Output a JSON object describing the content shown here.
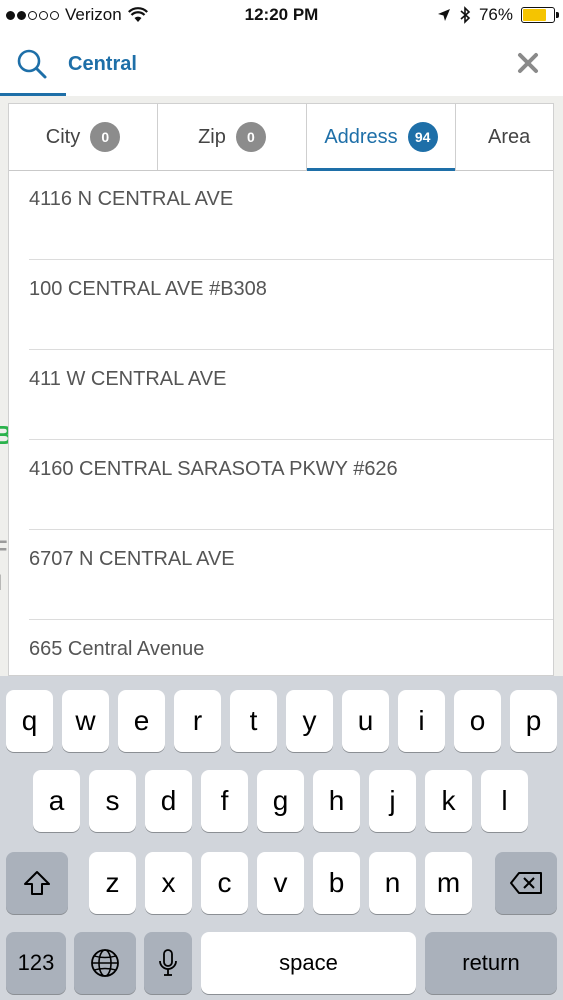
{
  "status_bar": {
    "carrier": "Verizon",
    "time": "12:20 PM",
    "battery": "76%",
    "battery_level": 0.76,
    "icons": [
      "signal-dots-icon",
      "wifi-icon",
      "location-arrow-icon",
      "bluetooth-icon",
      "battery-icon"
    ]
  },
  "search": {
    "value": "Central",
    "icon": "search-icon",
    "clear_icon": "close-icon"
  },
  "colors": {
    "accent": "#1e6fa8",
    "badge_inactive": "#8c8c8c",
    "battery": "#f5c400"
  },
  "tabs": [
    {
      "label": "City",
      "count": "0"
    },
    {
      "label": "Zip",
      "count": "0"
    },
    {
      "label": "Address",
      "count": "94"
    },
    {
      "label": "Area",
      "count": ""
    }
  ],
  "results": [
    "4116 N CENTRAL AVE",
    "100 CENTRAL AVE #B308",
    "411 W CENTRAL AVE",
    "4160 CENTRAL SARASOTA PKWY #626",
    "6707 N CENTRAL AVE",
    "665 Central Avenue"
  ],
  "map_fragments": [
    "B",
    "F",
    "I"
  ],
  "keyboard": {
    "row1": [
      "q",
      "w",
      "e",
      "r",
      "t",
      "y",
      "u",
      "i",
      "o",
      "p"
    ],
    "row2": [
      "a",
      "s",
      "d",
      "f",
      "g",
      "h",
      "j",
      "k",
      "l"
    ],
    "row3": [
      "z",
      "x",
      "c",
      "v",
      "b",
      "n",
      "m"
    ],
    "numbers_label": "123",
    "space_label": "space",
    "return_label": "return"
  }
}
